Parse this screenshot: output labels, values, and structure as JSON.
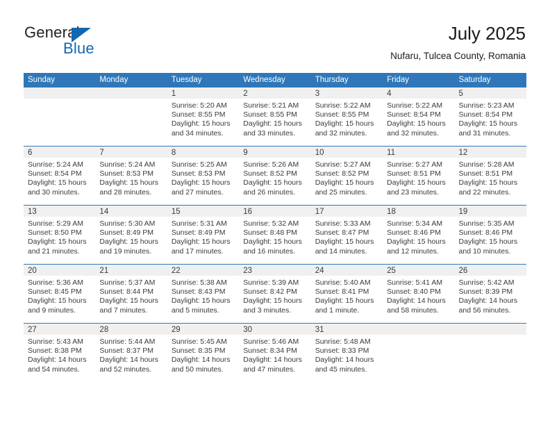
{
  "brand": {
    "name_top": "General",
    "name_bottom": "Blue",
    "triangle_color": "#1267b2"
  },
  "header": {
    "title": "July 2025",
    "subtitle": "Nufaru, Tulcea County, Romania"
  },
  "theme": {
    "header_blue": "#2f77b8",
    "daynum_band": "#f0f0f0",
    "text": "#3a3a3a"
  },
  "weekdays": [
    "Sunday",
    "Monday",
    "Tuesday",
    "Wednesday",
    "Thursday",
    "Friday",
    "Saturday"
  ],
  "weeks": [
    [
      {
        "day": "",
        "empty": true
      },
      {
        "day": "",
        "empty": true
      },
      {
        "day": "1",
        "sunrise": "Sunrise: 5:20 AM",
        "sunset": "Sunset: 8:55 PM",
        "daylight1": "Daylight: 15 hours",
        "daylight2": "and 34 minutes."
      },
      {
        "day": "2",
        "sunrise": "Sunrise: 5:21 AM",
        "sunset": "Sunset: 8:55 PM",
        "daylight1": "Daylight: 15 hours",
        "daylight2": "and 33 minutes."
      },
      {
        "day": "3",
        "sunrise": "Sunrise: 5:22 AM",
        "sunset": "Sunset: 8:55 PM",
        "daylight1": "Daylight: 15 hours",
        "daylight2": "and 32 minutes."
      },
      {
        "day": "4",
        "sunrise": "Sunrise: 5:22 AM",
        "sunset": "Sunset: 8:54 PM",
        "daylight1": "Daylight: 15 hours",
        "daylight2": "and 32 minutes."
      },
      {
        "day": "5",
        "sunrise": "Sunrise: 5:23 AM",
        "sunset": "Sunset: 8:54 PM",
        "daylight1": "Daylight: 15 hours",
        "daylight2": "and 31 minutes."
      }
    ],
    [
      {
        "day": "6",
        "sunrise": "Sunrise: 5:24 AM",
        "sunset": "Sunset: 8:54 PM",
        "daylight1": "Daylight: 15 hours",
        "daylight2": "and 30 minutes."
      },
      {
        "day": "7",
        "sunrise": "Sunrise: 5:24 AM",
        "sunset": "Sunset: 8:53 PM",
        "daylight1": "Daylight: 15 hours",
        "daylight2": "and 28 minutes."
      },
      {
        "day": "8",
        "sunrise": "Sunrise: 5:25 AM",
        "sunset": "Sunset: 8:53 PM",
        "daylight1": "Daylight: 15 hours",
        "daylight2": "and 27 minutes."
      },
      {
        "day": "9",
        "sunrise": "Sunrise: 5:26 AM",
        "sunset": "Sunset: 8:52 PM",
        "daylight1": "Daylight: 15 hours",
        "daylight2": "and 26 minutes."
      },
      {
        "day": "10",
        "sunrise": "Sunrise: 5:27 AM",
        "sunset": "Sunset: 8:52 PM",
        "daylight1": "Daylight: 15 hours",
        "daylight2": "and 25 minutes."
      },
      {
        "day": "11",
        "sunrise": "Sunrise: 5:27 AM",
        "sunset": "Sunset: 8:51 PM",
        "daylight1": "Daylight: 15 hours",
        "daylight2": "and 23 minutes."
      },
      {
        "day": "12",
        "sunrise": "Sunrise: 5:28 AM",
        "sunset": "Sunset: 8:51 PM",
        "daylight1": "Daylight: 15 hours",
        "daylight2": "and 22 minutes."
      }
    ],
    [
      {
        "day": "13",
        "sunrise": "Sunrise: 5:29 AM",
        "sunset": "Sunset: 8:50 PM",
        "daylight1": "Daylight: 15 hours",
        "daylight2": "and 21 minutes."
      },
      {
        "day": "14",
        "sunrise": "Sunrise: 5:30 AM",
        "sunset": "Sunset: 8:49 PM",
        "daylight1": "Daylight: 15 hours",
        "daylight2": "and 19 minutes."
      },
      {
        "day": "15",
        "sunrise": "Sunrise: 5:31 AM",
        "sunset": "Sunset: 8:49 PM",
        "daylight1": "Daylight: 15 hours",
        "daylight2": "and 17 minutes."
      },
      {
        "day": "16",
        "sunrise": "Sunrise: 5:32 AM",
        "sunset": "Sunset: 8:48 PM",
        "daylight1": "Daylight: 15 hours",
        "daylight2": "and 16 minutes."
      },
      {
        "day": "17",
        "sunrise": "Sunrise: 5:33 AM",
        "sunset": "Sunset: 8:47 PM",
        "daylight1": "Daylight: 15 hours",
        "daylight2": "and 14 minutes."
      },
      {
        "day": "18",
        "sunrise": "Sunrise: 5:34 AM",
        "sunset": "Sunset: 8:46 PM",
        "daylight1": "Daylight: 15 hours",
        "daylight2": "and 12 minutes."
      },
      {
        "day": "19",
        "sunrise": "Sunrise: 5:35 AM",
        "sunset": "Sunset: 8:46 PM",
        "daylight1": "Daylight: 15 hours",
        "daylight2": "and 10 minutes."
      }
    ],
    [
      {
        "day": "20",
        "sunrise": "Sunrise: 5:36 AM",
        "sunset": "Sunset: 8:45 PM",
        "daylight1": "Daylight: 15 hours",
        "daylight2": "and 9 minutes."
      },
      {
        "day": "21",
        "sunrise": "Sunrise: 5:37 AM",
        "sunset": "Sunset: 8:44 PM",
        "daylight1": "Daylight: 15 hours",
        "daylight2": "and 7 minutes."
      },
      {
        "day": "22",
        "sunrise": "Sunrise: 5:38 AM",
        "sunset": "Sunset: 8:43 PM",
        "daylight1": "Daylight: 15 hours",
        "daylight2": "and 5 minutes."
      },
      {
        "day": "23",
        "sunrise": "Sunrise: 5:39 AM",
        "sunset": "Sunset: 8:42 PM",
        "daylight1": "Daylight: 15 hours",
        "daylight2": "and 3 minutes."
      },
      {
        "day": "24",
        "sunrise": "Sunrise: 5:40 AM",
        "sunset": "Sunset: 8:41 PM",
        "daylight1": "Daylight: 15 hours",
        "daylight2": "and 1 minute."
      },
      {
        "day": "25",
        "sunrise": "Sunrise: 5:41 AM",
        "sunset": "Sunset: 8:40 PM",
        "daylight1": "Daylight: 14 hours",
        "daylight2": "and 58 minutes."
      },
      {
        "day": "26",
        "sunrise": "Sunrise: 5:42 AM",
        "sunset": "Sunset: 8:39 PM",
        "daylight1": "Daylight: 14 hours",
        "daylight2": "and 56 minutes."
      }
    ],
    [
      {
        "day": "27",
        "sunrise": "Sunrise: 5:43 AM",
        "sunset": "Sunset: 8:38 PM",
        "daylight1": "Daylight: 14 hours",
        "daylight2": "and 54 minutes."
      },
      {
        "day": "28",
        "sunrise": "Sunrise: 5:44 AM",
        "sunset": "Sunset: 8:37 PM",
        "daylight1": "Daylight: 14 hours",
        "daylight2": "and 52 minutes."
      },
      {
        "day": "29",
        "sunrise": "Sunrise: 5:45 AM",
        "sunset": "Sunset: 8:35 PM",
        "daylight1": "Daylight: 14 hours",
        "daylight2": "and 50 minutes."
      },
      {
        "day": "30",
        "sunrise": "Sunrise: 5:46 AM",
        "sunset": "Sunset: 8:34 PM",
        "daylight1": "Daylight: 14 hours",
        "daylight2": "and 47 minutes."
      },
      {
        "day": "31",
        "sunrise": "Sunrise: 5:48 AM",
        "sunset": "Sunset: 8:33 PM",
        "daylight1": "Daylight: 14 hours",
        "daylight2": "and 45 minutes."
      },
      {
        "day": "",
        "empty": true
      },
      {
        "day": "",
        "empty": true
      }
    ]
  ]
}
